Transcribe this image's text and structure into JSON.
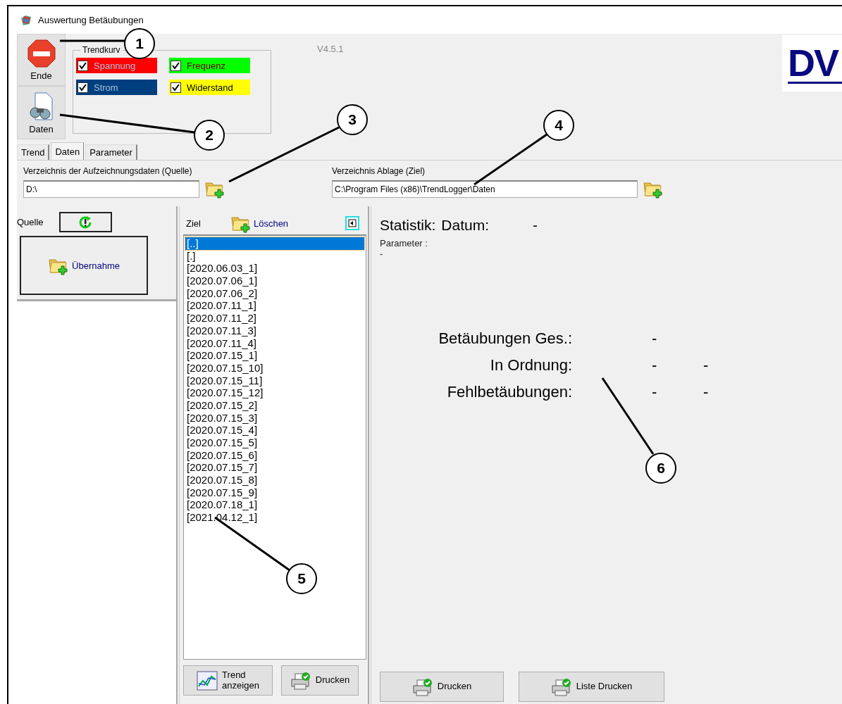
{
  "window": {
    "title": "Auswertung Betäubungen"
  },
  "toolbar": [
    {
      "kind": "stop",
      "label": "Ende"
    },
    {
      "kind": "data",
      "label": "Daten"
    }
  ],
  "trend_group": {
    "legend": "Trendkurv",
    "curves": [
      {
        "label": "Spannung",
        "checked": true,
        "color": "#ff0000"
      },
      {
        "label": "Frequenz",
        "checked": true,
        "color": "#00ff00"
      },
      {
        "label": "Strom",
        "checked": true,
        "color": "#003f7f"
      },
      {
        "label": "Widerstand",
        "checked": true,
        "color": "#ffff00"
      }
    ]
  },
  "version": "V4.5.1",
  "logo": "DV",
  "tabs": [
    {
      "label": "Trend",
      "selected": false
    },
    {
      "label": "Daten",
      "selected": true
    },
    {
      "label": "Parameter",
      "selected": false
    }
  ],
  "paths": [
    {
      "label": "Verzeichnis der Aufzeichnungsdaten (Quelle)",
      "value": "D:\\"
    },
    {
      "label": "Verzeichnis Ablage (Ziel)",
      "value": "C:\\Program Files (x86)\\TrendLogger\\Daten"
    }
  ],
  "source": {
    "label": "Quelle",
    "import_button": "Übernahme"
  },
  "target": {
    "label": "Ziel",
    "delete_button": "Löschen",
    "items": [
      {
        "text": "[..]",
        "selected": true
      },
      {
        "text": "[.]",
        "selected": false
      },
      {
        "text": "[2020.06.03_1]",
        "selected": false
      },
      {
        "text": "[2020.07.06_1]",
        "selected": false
      },
      {
        "text": "[2020.07.06_2]",
        "selected": false
      },
      {
        "text": "[2020.07.11_1]",
        "selected": false
      },
      {
        "text": "[2020.07.11_2]",
        "selected": false
      },
      {
        "text": "[2020.07.11_3]",
        "selected": false
      },
      {
        "text": "[2020.07.11_4]",
        "selected": false
      },
      {
        "text": "[2020.07.15_1]",
        "selected": false
      },
      {
        "text": "[2020.07.15_10]",
        "selected": false
      },
      {
        "text": "[2020.07.15_11]",
        "selected": false
      },
      {
        "text": "[2020.07.15_12]",
        "selected": false
      },
      {
        "text": "[2020.07.15_2]",
        "selected": false
      },
      {
        "text": "[2020.07.15_3]",
        "selected": false
      },
      {
        "text": "[2020.07.15_4]",
        "selected": false
      },
      {
        "text": "[2020.07.15_5]",
        "selected": false
      },
      {
        "text": "[2020.07.15_6]",
        "selected": false
      },
      {
        "text": "[2020.07.15_7]",
        "selected": false
      },
      {
        "text": "[2020.07.15_8]",
        "selected": false
      },
      {
        "text": "[2020.07.15_9]",
        "selected": false
      },
      {
        "text": "[2020.07.18_1]",
        "selected": false
      },
      {
        "text": "[2021.04.12_1]",
        "selected": false
      }
    ],
    "buttons": [
      {
        "kind": "trend",
        "label": "Trend\nanzeigen"
      },
      {
        "kind": "print",
        "label": "Drucken"
      }
    ]
  },
  "statistics": {
    "title": "Statistik:",
    "date_label": "Datum:",
    "date_value": "-",
    "parameter_label": "Parameter :",
    "parameter_value": "-",
    "rows": [
      {
        "label": "Betäubungen Ges.:",
        "values": [
          "-"
        ]
      },
      {
        "label": "In Ordnung:",
        "values": [
          "-",
          "-"
        ]
      },
      {
        "label": "Fehlbetäubungen:",
        "values": [
          "-",
          "-"
        ]
      }
    ],
    "buttons": [
      {
        "kind": "print",
        "label": "Drucken"
      },
      {
        "kind": "print",
        "label": "Liste Drucken"
      }
    ]
  },
  "callouts": [
    "1",
    "2",
    "3",
    "4",
    "5",
    "6"
  ]
}
